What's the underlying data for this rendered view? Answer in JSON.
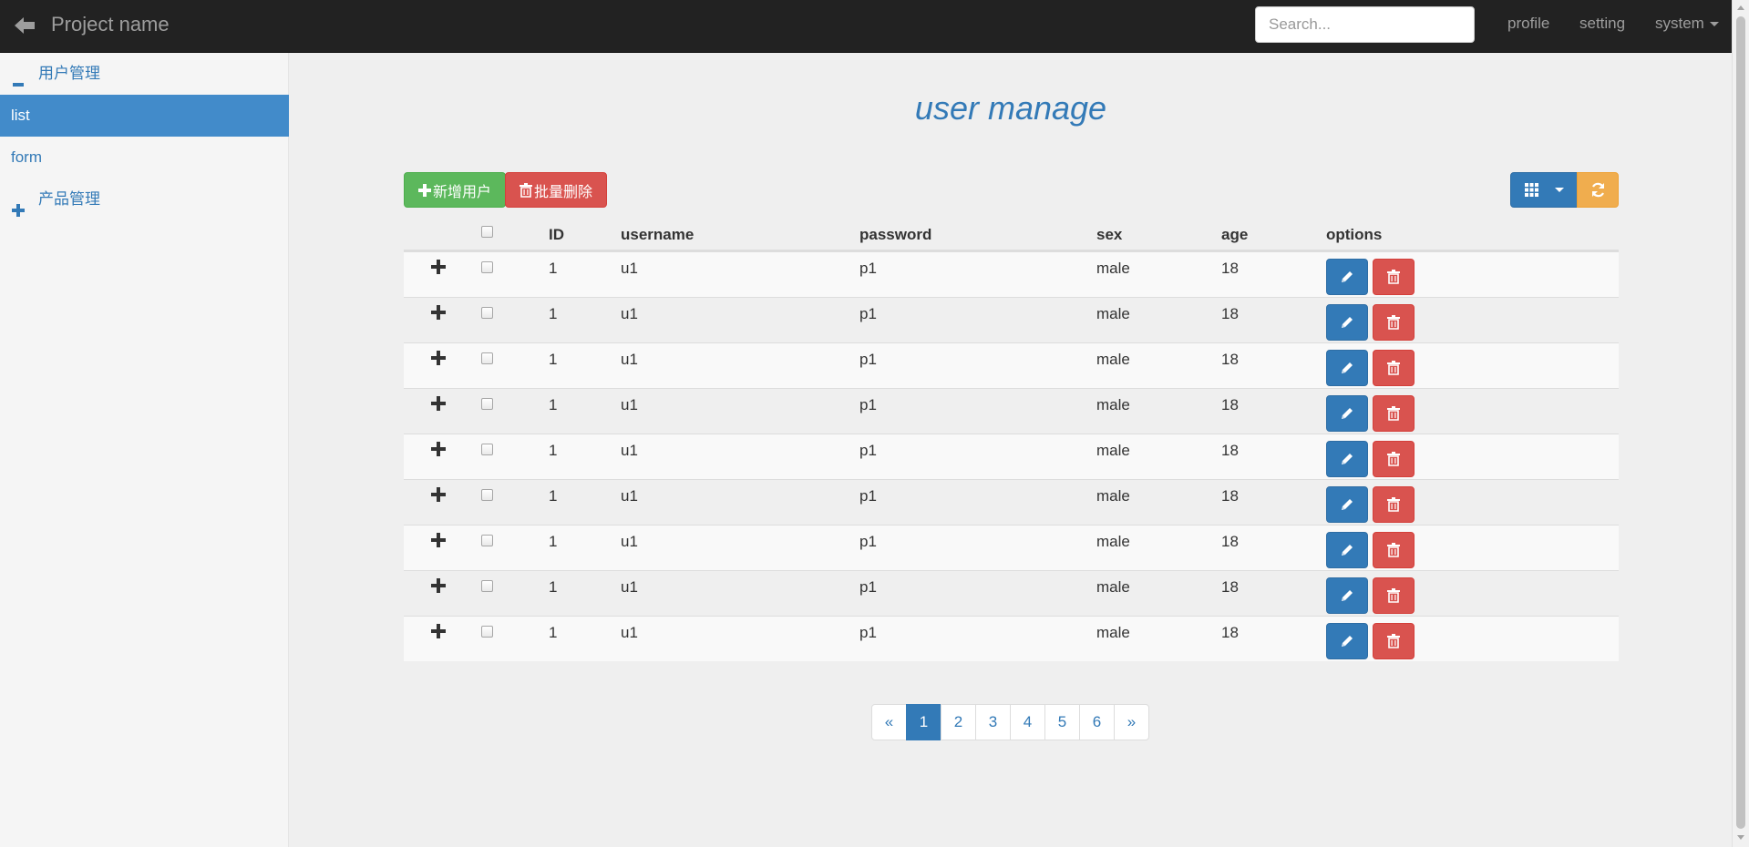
{
  "navbar": {
    "brand": "Project name",
    "search_placeholder": "Search...",
    "links": [
      "profile",
      "setting"
    ],
    "dropdown_label": "system"
  },
  "sidebar": {
    "groups": [
      {
        "label": "用户管理",
        "icon": "minus-icon",
        "expanded": true,
        "items": [
          {
            "label": "list",
            "active": true
          },
          {
            "label": "form",
            "active": false
          }
        ]
      },
      {
        "label": "产品管理",
        "icon": "plus-icon",
        "expanded": false,
        "items": []
      }
    ]
  },
  "main": {
    "title": "user manage",
    "toolbar": {
      "add_label": "新增用户",
      "batch_delete_label": "批量删除",
      "columns_icon": "grid-icon",
      "refresh_icon": "refresh-icon"
    },
    "table": {
      "headers": {
        "id": "ID",
        "username": "username",
        "password": "password",
        "sex": "sex",
        "age": "age",
        "options": "options"
      },
      "rows": [
        {
          "id": "1",
          "username": "u1",
          "password": "p1",
          "sex": "male",
          "age": "18"
        },
        {
          "id": "1",
          "username": "u1",
          "password": "p1",
          "sex": "male",
          "age": "18"
        },
        {
          "id": "1",
          "username": "u1",
          "password": "p1",
          "sex": "male",
          "age": "18"
        },
        {
          "id": "1",
          "username": "u1",
          "password": "p1",
          "sex": "male",
          "age": "18"
        },
        {
          "id": "1",
          "username": "u1",
          "password": "p1",
          "sex": "male",
          "age": "18"
        },
        {
          "id": "1",
          "username": "u1",
          "password": "p1",
          "sex": "male",
          "age": "18"
        },
        {
          "id": "1",
          "username": "u1",
          "password": "p1",
          "sex": "male",
          "age": "18"
        },
        {
          "id": "1",
          "username": "u1",
          "password": "p1",
          "sex": "male",
          "age": "18"
        },
        {
          "id": "1",
          "username": "u1",
          "password": "p1",
          "sex": "male",
          "age": "18"
        }
      ]
    },
    "pagination": {
      "prev": "«",
      "pages": [
        "1",
        "2",
        "3",
        "4",
        "5",
        "6"
      ],
      "current": "1",
      "next": "»"
    }
  },
  "colors": {
    "navbar_bg": "#222222",
    "primary": "#337ab7",
    "success": "#5cb85c",
    "danger": "#d9534f",
    "warning": "#f0ad4e",
    "sidebar_active": "#428bca"
  }
}
